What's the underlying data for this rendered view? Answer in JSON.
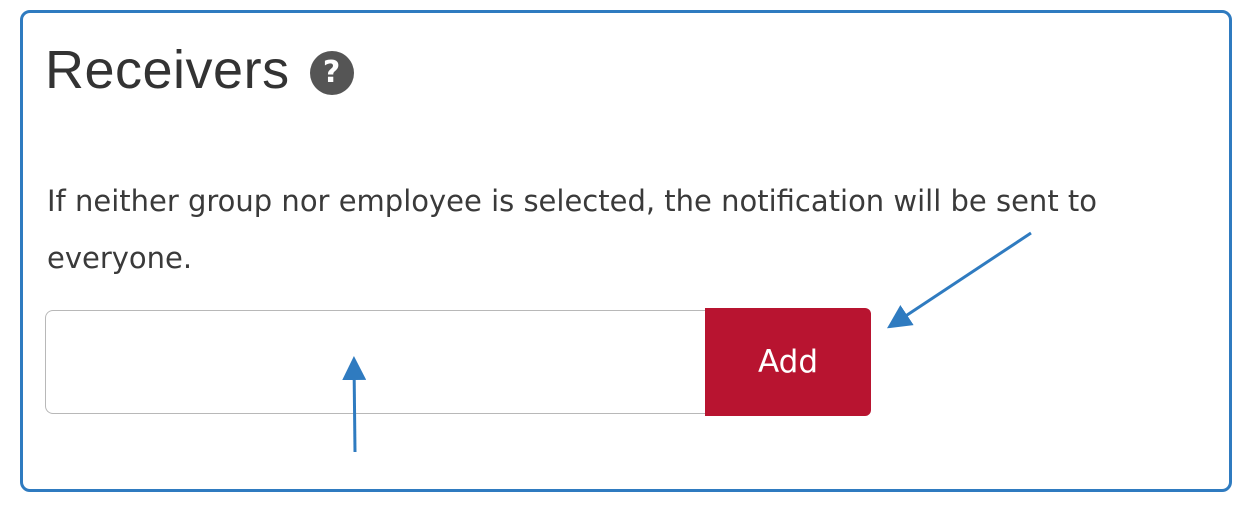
{
  "section": {
    "title": "Receivers",
    "help_icon": "question-mark-circle-icon",
    "description": "If neither group nor employee is selected, the notification will be sent to everyone."
  },
  "receiver_input": {
    "value": "",
    "placeholder": ""
  },
  "add_button": {
    "label": "Add",
    "color": "#b81430"
  },
  "annotation": {
    "frame_color": "#2f7bc0",
    "arrow_color": "#2f7bc0"
  }
}
